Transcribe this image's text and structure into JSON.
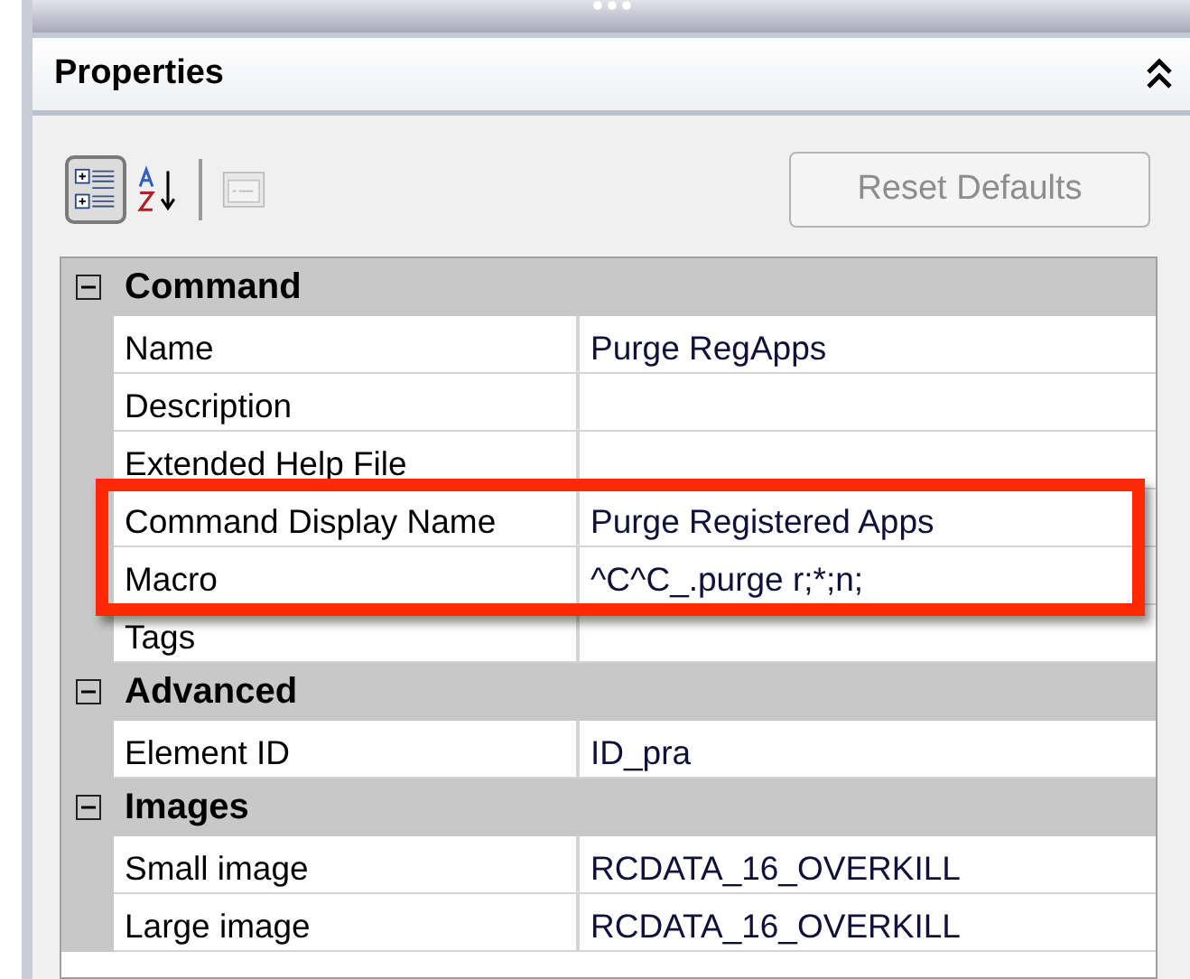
{
  "panel": {
    "title": "Properties"
  },
  "toolbar": {
    "tools": [
      {
        "kind": "categorized",
        "selected": true,
        "disabled": false
      },
      {
        "kind": "alphabetical",
        "selected": false,
        "disabled": false
      },
      {
        "kind": "pages",
        "selected": false,
        "disabled": true
      }
    ],
    "reset_button": {
      "label": "Reset Defaults",
      "disabled": true
    }
  },
  "categories": [
    {
      "name": "Command",
      "expanded": true,
      "properties": [
        {
          "name": "Name",
          "value": "Purge RegApps",
          "highlighted": false
        },
        {
          "name": "Description",
          "highlighted": false
        },
        {
          "name": "Extended Help File",
          "highlighted": false
        },
        {
          "name": "Command Display Name",
          "value": "Purge Registered Apps",
          "highlighted": true
        },
        {
          "name": "Macro",
          "value": "^C^C_.purge r;*;n;",
          "highlighted": true
        },
        {
          "name": "Tags",
          "highlighted": false
        }
      ]
    },
    {
      "name": "Advanced",
      "expanded": true,
      "properties": [
        {
          "name": "Element ID",
          "value": "ID_pra",
          "highlighted": false
        }
      ]
    },
    {
      "name": "Images",
      "expanded": true,
      "properties": [
        {
          "name": "Small image",
          "value": "RCDATA_16_OVERKILL",
          "highlighted": false
        },
        {
          "name": "Large image",
          "value": "RCDATA_16_OVERKILL",
          "highlighted": false
        }
      ]
    }
  ]
}
